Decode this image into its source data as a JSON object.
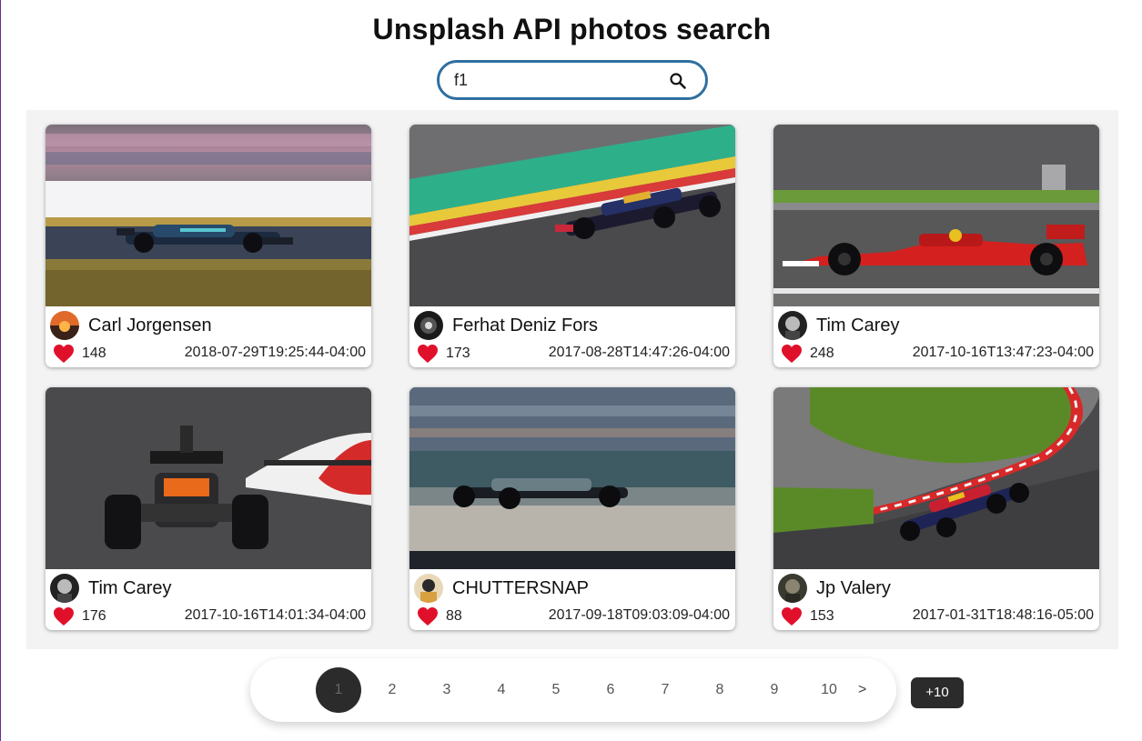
{
  "header": {
    "title": "Unsplash API photos search"
  },
  "search": {
    "value": "f1",
    "icon": "search-icon"
  },
  "photos": [
    {
      "author": "Carl Jorgensen",
      "likes": "148",
      "date": "2018-07-29T19:25:44-04:00"
    },
    {
      "author": "Ferhat Deniz Fors",
      "likes": "173",
      "date": "2017-08-28T14:47:26-04:00"
    },
    {
      "author": "Tim Carey",
      "likes": "248",
      "date": "2017-10-16T13:47:23-04:00"
    },
    {
      "author": "Tim Carey",
      "likes": "176",
      "date": "2017-10-16T14:01:34-04:00"
    },
    {
      "author": "CHUTTERSNAP",
      "likes": "88",
      "date": "2017-09-18T09:03:09-04:00"
    },
    {
      "author": "Jp Valery",
      "likes": "153",
      "date": "2017-01-31T18:48:16-05:00"
    }
  ],
  "pagination": {
    "pages": [
      "1",
      "2",
      "3",
      "4",
      "5",
      "6",
      "7",
      "8",
      "9",
      "10"
    ],
    "current": "1",
    "next_label": ">",
    "jump_label": "+10"
  },
  "colors": {
    "heart": "#e0102b",
    "search_border": "#2f6f9f",
    "active_page": "#2b2b2b"
  }
}
